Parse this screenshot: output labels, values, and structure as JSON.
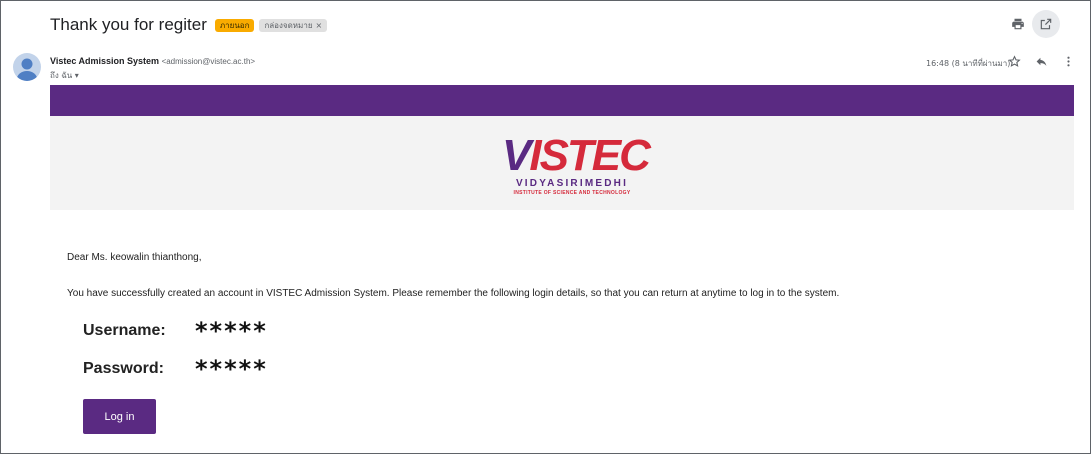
{
  "email": {
    "subject": "Thank you for regiter",
    "labels": {
      "external": "ภายนอก",
      "inbox": "กล่องจดหมาย",
      "inbox_remove": "×"
    },
    "sender_name": "Vistec Admission System",
    "sender_email": "<admission@vistec.ac.th>",
    "to_line": "ถึง ฉัน ▾",
    "timestamp": "16:48 (8 นาทีที่ผ่านมา)"
  },
  "icons": {
    "print": "print-icon",
    "open_new_window": "open-in-new-window-icon",
    "avatar": "person-avatar-icon",
    "star": "star-icon",
    "reply": "reply-icon",
    "more": "more-vertical-icon"
  },
  "brand": {
    "logo_v": "V",
    "logo_rest": "ISTEC",
    "logo_line1": "VIDYASIRIMEDHI",
    "logo_line2": "INSTITUTE OF SCIENCE AND TECHNOLOGY",
    "colors": {
      "purple": "#5a2a82",
      "red": "#d52a3b",
      "band": "#f3f3f3"
    }
  },
  "body": {
    "greeting": "Dear Ms. keowalin thianthong,",
    "message": "You have successfully created an account in VISTEC Admission System. Please remember the following login details, so that you can return at anytime to log in to the system.",
    "username_label": "Username:",
    "username_value": "*****",
    "password_label": "Password:",
    "password_value": "*****",
    "login_button": "Log in"
  }
}
